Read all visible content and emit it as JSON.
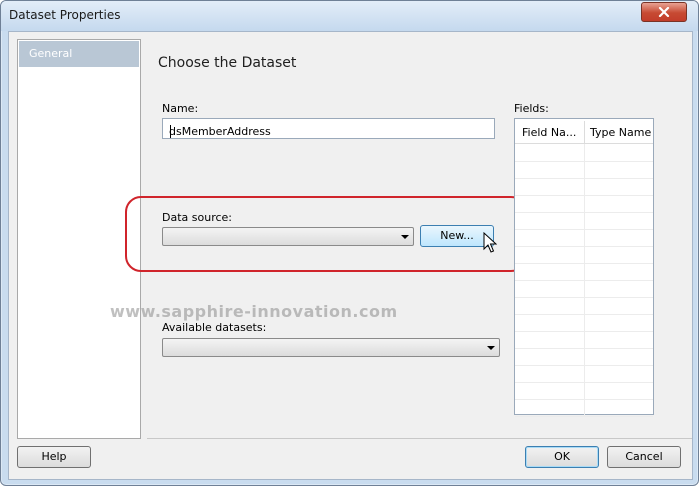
{
  "window": {
    "title": "Dataset Properties",
    "close_icon": "close-icon"
  },
  "nav": {
    "items": [
      {
        "label": "General",
        "selected": true
      }
    ]
  },
  "page": {
    "heading": "Choose the Dataset"
  },
  "name_field": {
    "label": "Name:",
    "value": "dsMemberAddress"
  },
  "data_source": {
    "label": "Data source:",
    "selected_value": "",
    "new_button_label": "New..."
  },
  "available_datasets": {
    "label": "Available datasets:",
    "selected_value": ""
  },
  "fields": {
    "label": "Fields:",
    "columns": [
      "Field Na...",
      "Type Name"
    ],
    "rows": []
  },
  "watermark": "www.sapphire-innovation.com",
  "footer": {
    "help_label": "Help",
    "ok_label": "OK",
    "cancel_label": "Cancel"
  },
  "colors": {
    "highlight": "#d0242b",
    "nav_selected": "#b9c7d5",
    "title_gradient_top": "#e3edf8"
  }
}
